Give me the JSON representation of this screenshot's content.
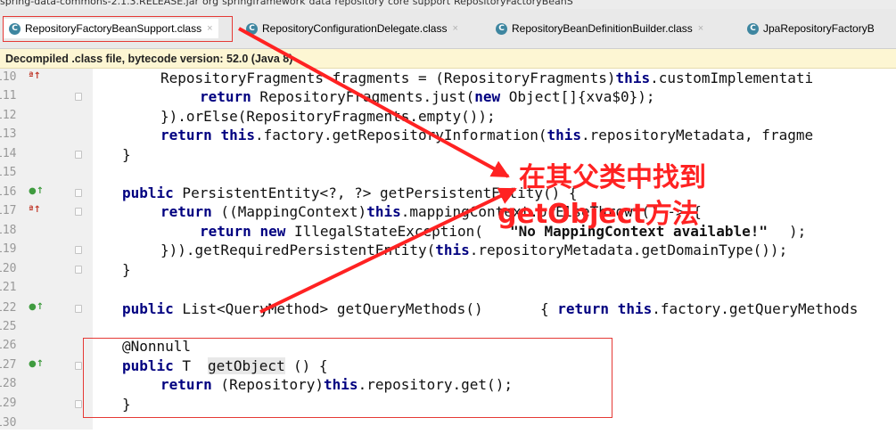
{
  "breadcrumb": [
    "spring-data-commons-2.1.3.RELEASE.jar",
    "org",
    "springframework",
    "data",
    "repository",
    "core",
    "support",
    "RepositoryFactoryBeanS"
  ],
  "tabs": [
    {
      "label": "RepositoryFactoryBeanSupport.class",
      "icon": "class-c-icon",
      "active": true
    },
    {
      "label": "RepositoryConfigurationDelegate.class",
      "icon": "class-c-icon",
      "active": false
    },
    {
      "label": "RepositoryBeanDefinitionBuilder.class",
      "icon": "class-c-icon",
      "active": false
    },
    {
      "label": "JpaRepositoryFactoryB",
      "icon": "class-c-icon",
      "active": false
    }
  ],
  "tab_close_glyph": "×",
  "class_icon_letter": "C",
  "banner": "Decompiled .class file, bytecode version: 52.0 (Java 8)",
  "lines": [
    {
      "n": "110",
      "marker": "override"
    },
    {
      "n": "111"
    },
    {
      "n": "112"
    },
    {
      "n": "113"
    },
    {
      "n": "114"
    },
    {
      "n": "115"
    },
    {
      "n": "116",
      "marker": "implement"
    },
    {
      "n": "117",
      "marker": "override"
    },
    {
      "n": "118"
    },
    {
      "n": "119"
    },
    {
      "n": "120"
    },
    {
      "n": "121"
    },
    {
      "n": "122",
      "marker": "implement"
    },
    {
      "n": "125"
    },
    {
      "n": "126"
    },
    {
      "n": "127",
      "marker": "implement"
    },
    {
      "n": "128"
    },
    {
      "n": "129"
    },
    {
      "n": "130"
    }
  ],
  "marker_glyphs": {
    "override": "ª↑",
    "implement": "●↑"
  },
  "code": {
    "l110": "RepositoryFragments fragments = (RepositoryFragments)this.customImplementati",
    "l111": "return RepositoryFragments.just(new Object[]{xva$0});",
    "l112": "}).orElse(RepositoryFragments.empty());",
    "l113": "return this.factory.getRepositoryInformation(this.repositoryMetadata, fragme",
    "l114": "}",
    "l116": "public PersistentEntity<?, ?> getPersistentEntity() {",
    "l117": "return ((MappingContext)this.mappingContext.orElseThrow(() -> {",
    "l118_a": "return new IllegalStateException(",
    "l118_s": "\"No MappingContext available!\"",
    "l118_b": ");",
    "l119": "})).getRequiredPersistentEntity(this.repositoryMetadata.getDomainType());",
    "l120": "}",
    "l122_a": "public List<QueryMethod> getQueryMethods() ",
    "l122_b": "{ return this.factory.getQueryMethods",
    "l126": "@Nonnull",
    "l127_a": "public T ",
    "l127_m": "getObject",
    "l127_b": "() {",
    "l128": "return (Repository)this.repository.get();",
    "l129": "}"
  },
  "annotation": {
    "line1": "在其父类中找到",
    "line2": "getObject方法",
    "color": "#ff2222"
  },
  "colors": {
    "keyword": "#000080",
    "string": "#008000",
    "annotation_box": "#e53935",
    "banner_bg": "#fdf6d3"
  }
}
